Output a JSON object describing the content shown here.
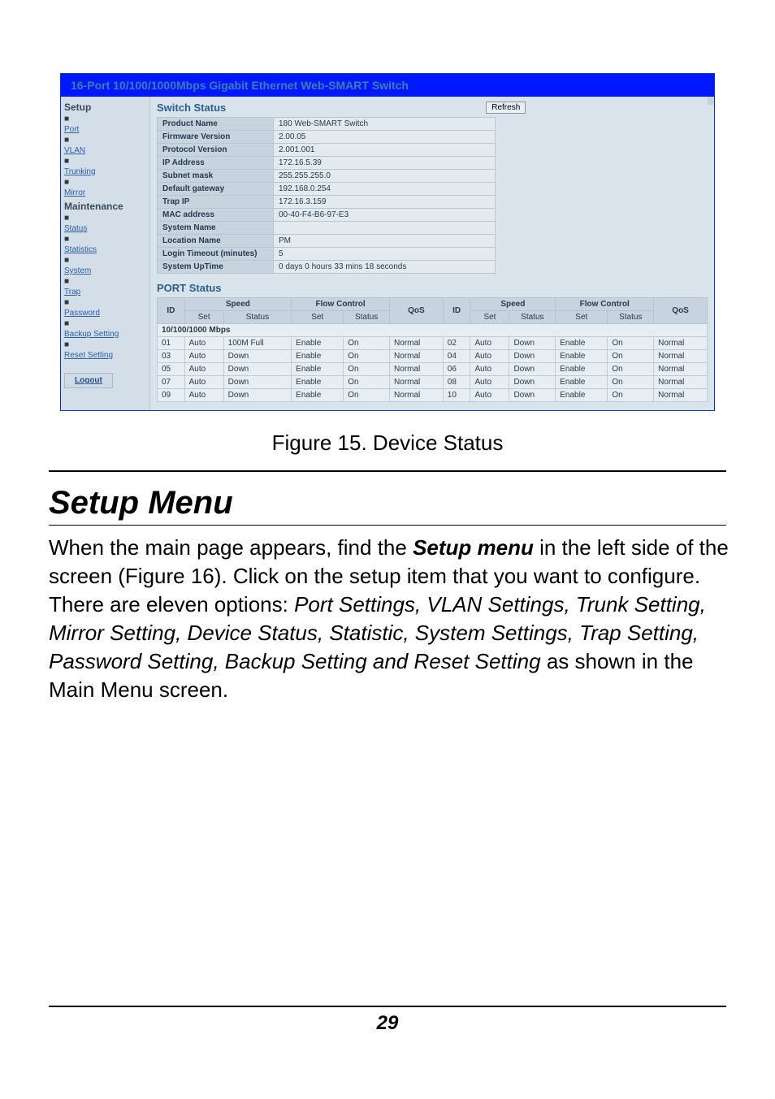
{
  "titlebar": "16-Port 10/100/1000Mbps Gigabit Ethernet Web-SMART Switch",
  "sidebar": {
    "setup": "Setup",
    "items_setup": [
      "Port",
      "VLAN",
      "Trunking",
      "Mirror"
    ],
    "maintenance": "Maintenance",
    "items_maint": [
      "Status",
      "Statistics",
      "System",
      "Trap",
      "Password",
      "Backup Setting",
      "Reset Setting"
    ],
    "logout": "Logout"
  },
  "switch_status_title": "Switch Status",
  "refresh": "Refresh",
  "kv": [
    {
      "k": "Product Name",
      "v": "180 Web-SMART Switch"
    },
    {
      "k": "Firmware Version",
      "v": "2.00.05"
    },
    {
      "k": "Protocol Version",
      "v": "2.001.001"
    },
    {
      "k": "IP Address",
      "v": "172.16.5.39"
    },
    {
      "k": "Subnet mask",
      "v": "255.255.255.0"
    },
    {
      "k": "Default gateway",
      "v": "192.168.0.254"
    },
    {
      "k": "Trap IP",
      "v": "172.16.3.159"
    },
    {
      "k": "MAC address",
      "v": "00-40-F4-B6-97-E3"
    },
    {
      "k": "System Name",
      "v": ""
    },
    {
      "k": "Location Name",
      "v": "PM"
    },
    {
      "k": "Login Timeout (minutes)",
      "v": "5"
    },
    {
      "k": "System UpTime",
      "v": "0 days 0 hours 33 mins 18 seconds"
    }
  ],
  "port_status_title": "PORT Status",
  "cols": {
    "id": "ID",
    "speed": "Speed",
    "flow": "Flow Control",
    "qos": "QoS",
    "set": "Set",
    "status": "Status"
  },
  "band": "10/100/1000 Mbps",
  "rows": [
    {
      "l": {
        "id": "01",
        "speed_set": "Auto",
        "speed_status": "100M Full",
        "fc_set": "Enable",
        "fc_status": "On",
        "qos": "Normal"
      },
      "r": {
        "id": "02",
        "speed_set": "Auto",
        "speed_status": "Down",
        "fc_set": "Enable",
        "fc_status": "On",
        "qos": "Normal"
      }
    },
    {
      "l": {
        "id": "03",
        "speed_set": "Auto",
        "speed_status": "Down",
        "fc_set": "Enable",
        "fc_status": "On",
        "qos": "Normal"
      },
      "r": {
        "id": "04",
        "speed_set": "Auto",
        "speed_status": "Down",
        "fc_set": "Enable",
        "fc_status": "On",
        "qos": "Normal"
      }
    },
    {
      "l": {
        "id": "05",
        "speed_set": "Auto",
        "speed_status": "Down",
        "fc_set": "Enable",
        "fc_status": "On",
        "qos": "Normal"
      },
      "r": {
        "id": "06",
        "speed_set": "Auto",
        "speed_status": "Down",
        "fc_set": "Enable",
        "fc_status": "On",
        "qos": "Normal"
      }
    },
    {
      "l": {
        "id": "07",
        "speed_set": "Auto",
        "speed_status": "Down",
        "fc_set": "Enable",
        "fc_status": "On",
        "qos": "Normal"
      },
      "r": {
        "id": "08",
        "speed_set": "Auto",
        "speed_status": "Down",
        "fc_set": "Enable",
        "fc_status": "On",
        "qos": "Normal"
      }
    },
    {
      "l": {
        "id": "09",
        "speed_set": "Auto",
        "speed_status": "Down",
        "fc_set": "Enable",
        "fc_status": "On",
        "qos": "Normal"
      },
      "r": {
        "id": "10",
        "speed_set": "Auto",
        "speed_status": "Down",
        "fc_set": "Enable",
        "fc_status": "On",
        "qos": "Normal"
      }
    }
  ],
  "caption": "Figure 15. Device Status",
  "setup_menu": "Setup Menu",
  "para": {
    "p1a": "When the main page appears, find the ",
    "p1b": "Setup menu",
    "p1c": " in the left side of the screen (Figure 16). Click on the setup item that you want to configure. There are eleven options: ",
    "p1d": "Port Settings, VLAN Settings, Trunk Setting, Mirror Setting, Device Status, Statistic, System Settings, Trap Setting, Password Setting, Backup Setting and Reset Setting",
    "p1e": " as shown in the Main Menu screen."
  },
  "page_number": "29"
}
